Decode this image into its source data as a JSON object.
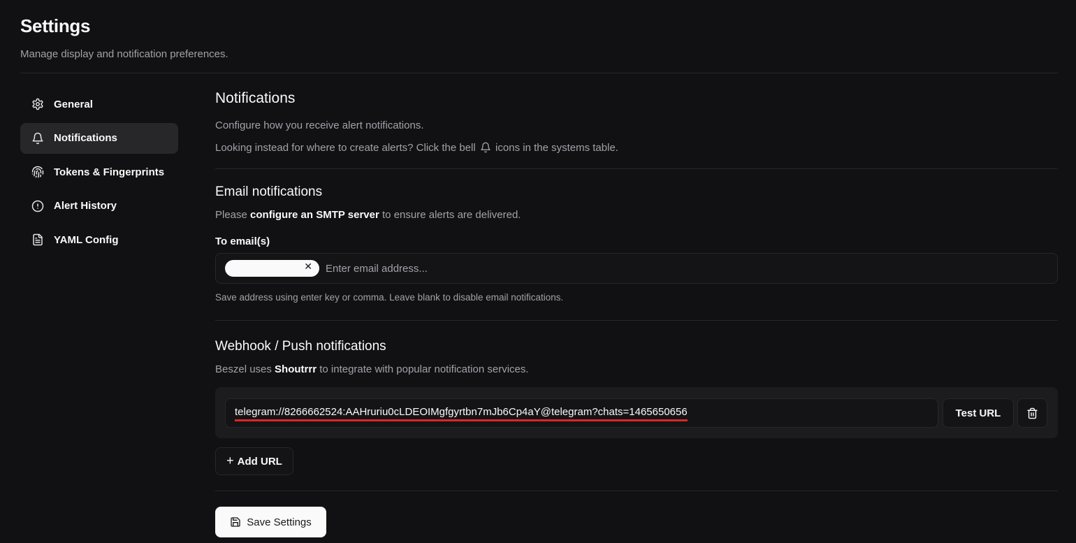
{
  "header": {
    "title": "Settings",
    "subtitle": "Manage display and notification preferences."
  },
  "sidebar": {
    "items": [
      {
        "label": "General",
        "icon": "gear-icon",
        "active": false
      },
      {
        "label": "Notifications",
        "icon": "bell-icon",
        "active": true
      },
      {
        "label": "Tokens & Fingerprints",
        "icon": "fingerprint-icon",
        "active": false
      },
      {
        "label": "Alert History",
        "icon": "alert-circle-icon",
        "active": false
      },
      {
        "label": "YAML Config",
        "icon": "file-icon",
        "active": false
      }
    ]
  },
  "notifications": {
    "title": "Notifications",
    "description": "Configure how you receive alert notifications.",
    "hint_before": "Looking instead for where to create alerts? Click the bell",
    "hint_after": "icons in the systems table."
  },
  "email": {
    "title": "Email notifications",
    "desc_before": "Please",
    "desc_link": "configure an SMTP server",
    "desc_after": "to ensure alerts are delivered.",
    "field_label": "To email(s)",
    "placeholder": "Enter email address...",
    "help": "Save address using enter key or comma. Leave blank to disable email notifications."
  },
  "webhook": {
    "title": "Webhook / Push notifications",
    "desc_before": "Beszel uses",
    "desc_link": "Shoutrrr",
    "desc_after": "to integrate with popular notification services.",
    "url": "telegram://8266662524:AAHruriu0cLDEOIMgfgyrtbn7mJb6Cp4aY@telegram?chats=1465650656",
    "test_label": "Test URL",
    "add_label": "Add URL"
  },
  "save_label": "Save Settings",
  "colors": {
    "background": "#111113",
    "active_item": "#27272a",
    "border": "#27272a",
    "card": "#1c1c1f",
    "underline": "#dc2626"
  }
}
